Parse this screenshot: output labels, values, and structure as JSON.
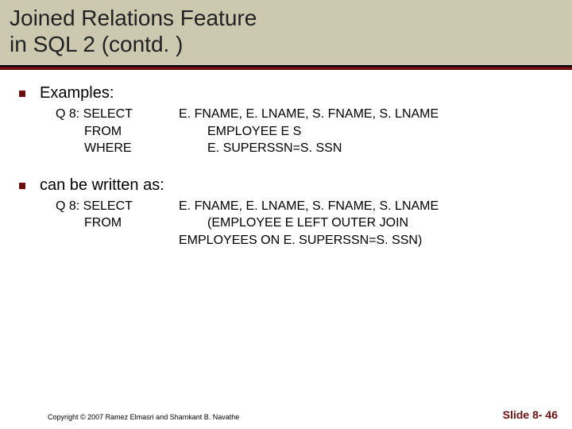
{
  "title_line1": "Joined Relations Feature",
  "title_line2": "in SQL 2 (contd. )",
  "sections": [
    {
      "heading": "Examples:",
      "query": {
        "rows": [
          {
            "kw": "Q 8: SELECT",
            "val": "E. FNAME, E. LNAME, S. FNAME, S. LNAME"
          },
          {
            "kw": "FROM",
            "val": "EMPLOYEE E S"
          },
          {
            "kw": "WHERE",
            "val": "E. SUPERSSN=S. SSN"
          }
        ]
      }
    },
    {
      "heading": "can be written as:",
      "query": {
        "rows": [
          {
            "kw": "Q 8: SELECT",
            "val": "E. FNAME, E. LNAME, S. FNAME, S. LNAME"
          },
          {
            "kw": "FROM",
            "val": "(EMPLOYEE E LEFT OUTER JOIN"
          },
          {
            "kw": "",
            "val": "EMPLOYEES ON  E. SUPERSSN=S. SSN)"
          }
        ]
      }
    }
  ],
  "footer": {
    "copyright": "Copyright © 2007 Ramez Elmasri and Shamkant B. Navathe",
    "slide": "Slide 8- 46"
  }
}
